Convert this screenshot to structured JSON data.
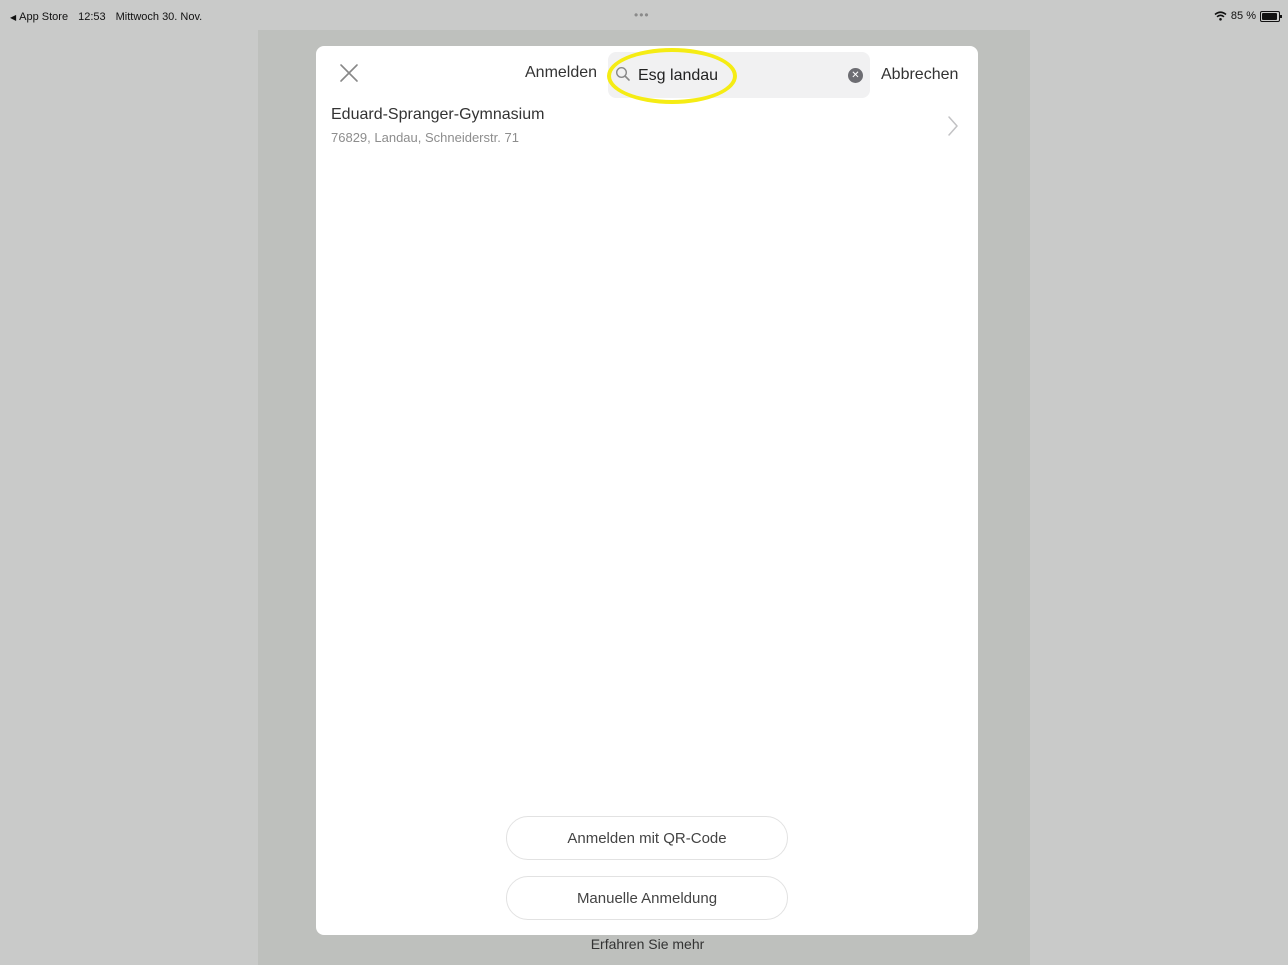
{
  "status_bar": {
    "back_app": "App Store",
    "time": "12:53",
    "date": "Mittwoch 30. Nov.",
    "dots": "•••",
    "battery": "85 %",
    "battery_level_percent": 85,
    "back_icon": "back-triangle-icon",
    "wifi_icon": "wifi-icon"
  },
  "modal": {
    "title": "Anmelden",
    "search": {
      "value": "Esg landau",
      "search_icon": "magnifier-icon",
      "clear_icon": "clear-icon"
    },
    "cancel_label": "Abbrechen",
    "results": [
      {
        "name": "Eduard-Spranger-Gymnasium",
        "address": "76829, Landau, Schneiderstr. 71"
      }
    ],
    "qr_button_label": "Anmelden mit QR-Code",
    "manual_button_label": "Manuelle Anmeldung"
  },
  "footer": {
    "learn_more": "Erfahren Sie mehr"
  },
  "colors": {
    "background": "#c9cac9",
    "modal": "#ffffff",
    "highlight": "#f5ec14",
    "search_field": "#f1f1f2"
  }
}
